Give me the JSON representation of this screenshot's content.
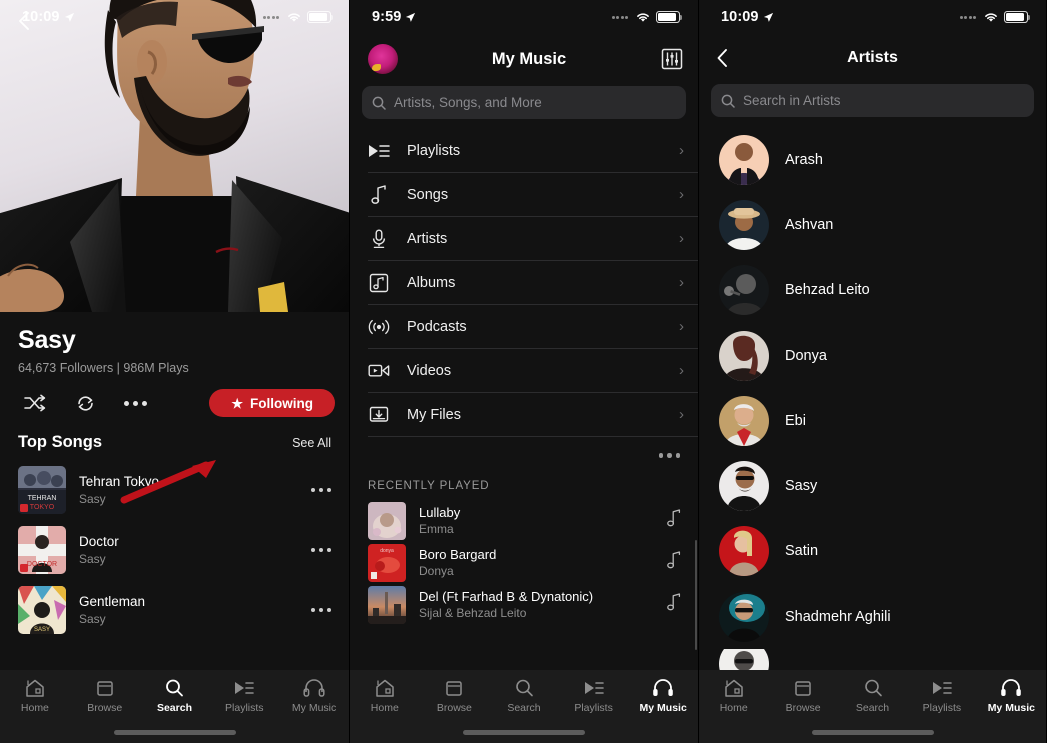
{
  "panel1": {
    "status": {
      "time": "10:09",
      "location_icon": "location-arrow-icon",
      "wifi_icon": "wifi-icon",
      "battery_icon": "battery-icon"
    },
    "back_icon": "back-chevron-icon",
    "hero_image_alt": "artist-photo",
    "artist": {
      "name": "Sasy",
      "stats": "64,673 Followers | 986M Plays"
    },
    "actions": {
      "shuffle_icon": "shuffle-icon",
      "repeat_icon": "repeat-icon",
      "more_icon": "more-ellipsis-icon",
      "follow_label": "Following",
      "follow_star_icon": "star-icon",
      "follow_color": "#c72026"
    },
    "annotation": {
      "arrow_icon": "red-arrow-annotation",
      "color": "#c0121a"
    },
    "section": {
      "title": "Top Songs",
      "see_all": "See All"
    },
    "songs": [
      {
        "title": "Tehran Tokyo",
        "artist": "Sasy",
        "more_icon": "more-ellipsis-icon"
      },
      {
        "title": "Doctor",
        "artist": "Sasy",
        "more_icon": "more-ellipsis-icon"
      },
      {
        "title": "Gentleman",
        "artist": "Sasy",
        "more_icon": "more-ellipsis-icon"
      }
    ],
    "tabs": [
      {
        "label": "Home",
        "icon": "home-icon",
        "active": false
      },
      {
        "label": "Browse",
        "icon": "browse-icon",
        "active": false
      },
      {
        "label": "Search",
        "icon": "search-icon",
        "active": true
      },
      {
        "label": "Playlists",
        "icon": "playlists-icon",
        "active": false
      },
      {
        "label": "My Music",
        "icon": "headphones-icon",
        "active": false
      }
    ]
  },
  "panel2": {
    "status": {
      "time": "9:59",
      "location_icon": "location-arrow-icon",
      "wifi_icon": "wifi-icon",
      "battery_icon": "battery-icon"
    },
    "header": {
      "title": "My Music",
      "avatar_icon": "user-avatar",
      "equalizer_icon": "equalizer-icon"
    },
    "search": {
      "placeholder": "Artists, Songs, and More",
      "icon": "search-icon"
    },
    "menu": [
      {
        "label": "Playlists",
        "icon": "playlists-icon",
        "chevron": "›"
      },
      {
        "label": "Songs",
        "icon": "music-note-icon",
        "chevron": "›"
      },
      {
        "label": "Artists",
        "icon": "microphone-icon",
        "chevron": "›"
      },
      {
        "label": "Albums",
        "icon": "album-icon",
        "chevron": "›"
      },
      {
        "label": "Podcasts",
        "icon": "podcast-icon",
        "chevron": "›"
      },
      {
        "label": "Videos",
        "icon": "video-icon",
        "chevron": "›"
      },
      {
        "label": "My Files",
        "icon": "download-box-icon",
        "chevron": "›"
      }
    ],
    "more_icon": "more-ellipsis-icon",
    "recently_played": {
      "heading": "RECENTLY PLAYED",
      "items": [
        {
          "title": "Lullaby",
          "artist": "Emma",
          "action_icon": "music-note-icon"
        },
        {
          "title": "Boro Bargard",
          "artist": "Donya",
          "action_icon": "music-note-icon"
        },
        {
          "title": "Del (Ft Farhad B & Dynatonic)",
          "artist": "Sijal & Behzad Leito",
          "action_icon": "music-note-icon"
        }
      ]
    },
    "tabs": [
      {
        "label": "Home",
        "icon": "home-icon",
        "active": false
      },
      {
        "label": "Browse",
        "icon": "browse-icon",
        "active": false
      },
      {
        "label": "Search",
        "icon": "search-icon",
        "active": false
      },
      {
        "label": "Playlists",
        "icon": "playlists-icon",
        "active": false
      },
      {
        "label": "My Music",
        "icon": "headphones-icon",
        "active": true
      }
    ]
  },
  "panel3": {
    "status": {
      "time": "10:09",
      "location_icon": "location-arrow-icon",
      "wifi_icon": "wifi-icon",
      "battery_icon": "battery-icon"
    },
    "header": {
      "title": "Artists",
      "back_icon": "back-chevron-icon"
    },
    "search": {
      "placeholder": "Search in Artists",
      "icon": "search-icon"
    },
    "artists": [
      {
        "name": "Arash"
      },
      {
        "name": "Ashvan"
      },
      {
        "name": "Behzad Leito"
      },
      {
        "name": "Donya"
      },
      {
        "name": "Ebi"
      },
      {
        "name": "Sasy"
      },
      {
        "name": "Satin"
      },
      {
        "name": "Shadmehr Aghili"
      }
    ],
    "tabs": [
      {
        "label": "Home",
        "icon": "home-icon",
        "active": false
      },
      {
        "label": "Browse",
        "icon": "browse-icon",
        "active": false
      },
      {
        "label": "Search",
        "icon": "search-icon",
        "active": false
      },
      {
        "label": "Playlists",
        "icon": "playlists-icon",
        "active": false
      },
      {
        "label": "My Music",
        "icon": "headphones-icon",
        "active": true
      }
    ]
  }
}
